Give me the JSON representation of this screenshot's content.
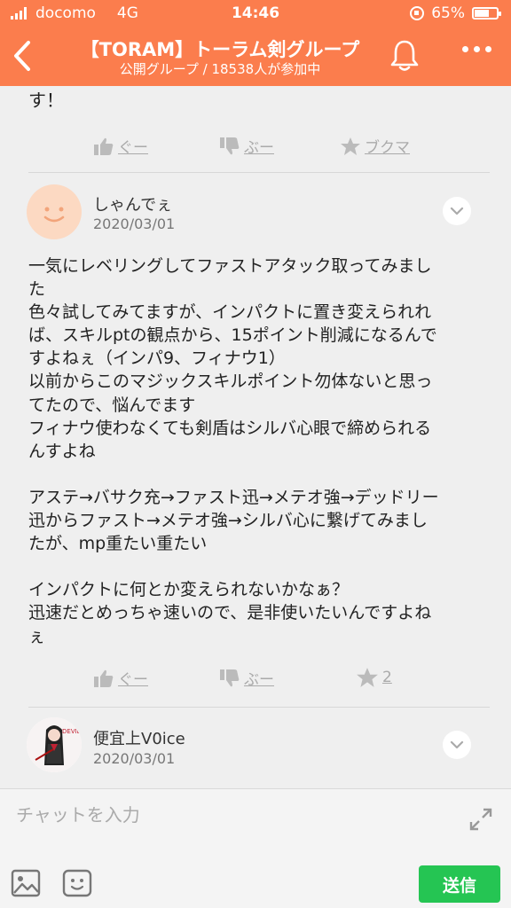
{
  "status_bar": {
    "carrier": "docomo",
    "network": "4G",
    "time": "14:46",
    "battery": "65%",
    "battery_level": 0.65
  },
  "header": {
    "title": "【TORAM】トーラム剣グループ",
    "subtitle": "公開グループ / 18538人が参加中"
  },
  "previous_post": {
    "text_tail": "す！",
    "actions": {
      "like": "ぐー",
      "dislike": "ぶー",
      "bookmark": "ブクマ"
    }
  },
  "post": {
    "author": "しゃんでぇ",
    "date": "2020/03/01",
    "lines": [
      "一気にレベリングしてファストアタック取ってみまし",
      "た",
      "色々試してみてますが、インパクトに置き変えられれ",
      "ば、スキルptの観点から、15ポイント削減になるんで",
      "すよねぇ（インパ9、フィナウ1）",
      "以前からこのマジックスキルポイント勿体ないと思っ",
      "てたので、悩んでます",
      "フィナウ使わなくても剣盾はシルバ心眼で締められる",
      "んすよね",
      "",
      "アステ→バサク充→ファスト迅→メテオ強→デッドリー",
      "迅からファスト→メテオ強→シルバ心に繋げてみまし",
      "たが、mp重たい重たい",
      "",
      "インパクトに何とか変えられないかなぁ？",
      "迅速だとめっちゃ速いので、是非使いたいんですよね",
      "ぇ"
    ],
    "actions": {
      "like": "ぐー",
      "dislike": "ぶー",
      "bookmark_count": "2"
    }
  },
  "next_post": {
    "author": "便宜上V0ice",
    "date": "2020/03/01",
    "avatar_text": "DEVIL"
  },
  "input_bar": {
    "placeholder": "チャットを入力",
    "send_label": "送信"
  },
  "colors": {
    "header": "#fb7d4d",
    "send": "#25c553",
    "background": "#efefef"
  }
}
